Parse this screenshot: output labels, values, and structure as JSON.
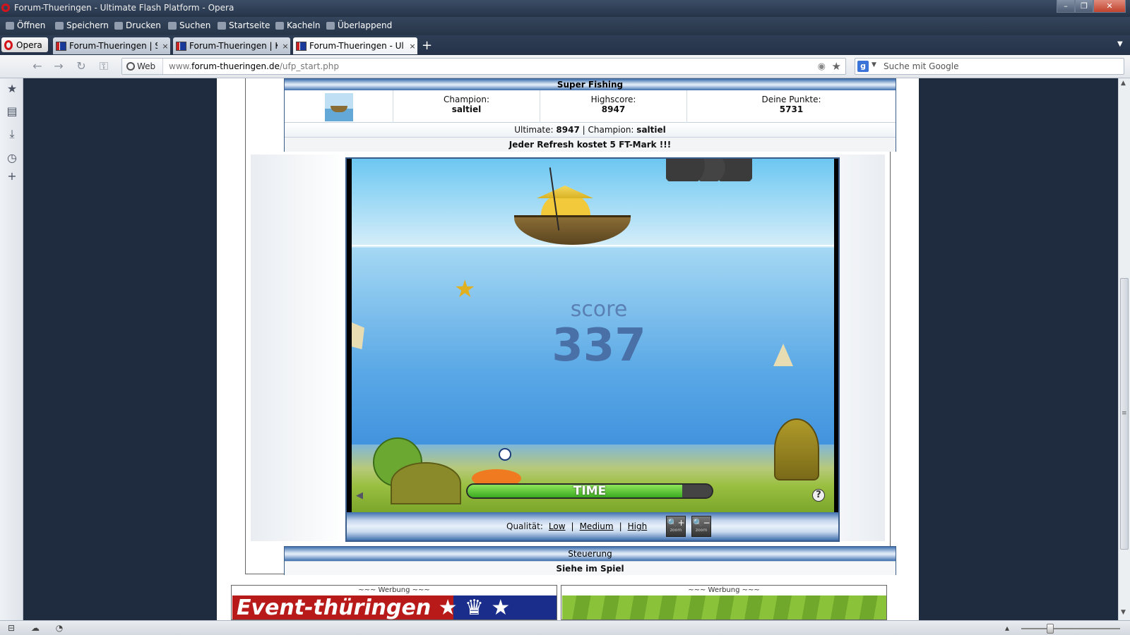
{
  "window": {
    "title": "Forum-Thueringen - Ultimate Flash Platform - Opera",
    "minimize": "–",
    "restore": "❐",
    "close": "✕"
  },
  "menubar": {
    "items": [
      {
        "label": "Öffnen",
        "icon": "folder-icon"
      },
      {
        "label": "Speichern",
        "icon": "save-icon"
      },
      {
        "label": "Drucken",
        "icon": "print-icon"
      },
      {
        "label": "Suchen",
        "icon": "search-icon"
      },
      {
        "label": "Startseite",
        "icon": "home-icon"
      },
      {
        "label": "Kacheln",
        "icon": "tile-icon"
      },
      {
        "label": "Überlappend",
        "icon": "cascade-icon"
      }
    ]
  },
  "tabs": {
    "opera_button": "Opera",
    "items": [
      {
        "title": "Forum-Thueringen | Sp...",
        "active": false
      },
      {
        "title": "Forum-Thueringen | K...",
        "active": false
      },
      {
        "title": "Forum-Thueringen - Ul...",
        "active": true
      }
    ],
    "new_tab": "+",
    "close_glyph": "×"
  },
  "address": {
    "web_label": "Web",
    "url_host": "www.forum-thueringen.de",
    "url_prefix": "www.",
    "url_domain": "forum-thueringen.de",
    "url_path": "/ufp_start.php",
    "search_placeholder": "Suche mit Google",
    "search_engine": "g"
  },
  "game_info": {
    "title": "Super Fishing",
    "champion_label": "Champion:",
    "champion": "saltiel",
    "highscore_label": "Highscore:",
    "highscore": "8947",
    "points_label": "Deine Punkte:",
    "points": "5731",
    "ultimate_label": "Ultimate:",
    "ultimate_value": "8947",
    "sep": "|",
    "champion_label2": "Champion:",
    "champion2": "saltiel",
    "refresh_notice": "Jeder Refresh kostet 5 FT-Mark !!!"
  },
  "game": {
    "score_label": "score",
    "score_value": "337",
    "time_label": "TIME",
    "time_remaining_fraction": 0.88,
    "help": "?"
  },
  "quality": {
    "label": "Qualität:",
    "low": "Low",
    "medium": "Medium",
    "high": "High",
    "zoom_in": "🔍+",
    "zoom_out": "🔍−",
    "zoom_text": "zoom"
  },
  "controls": {
    "title": "Steuerung",
    "text": "Siehe im Spiel"
  },
  "ads": {
    "label": "~~~ Werbung ~~~",
    "banner1_text": "Event-thüringen ★ ♛ ★"
  }
}
